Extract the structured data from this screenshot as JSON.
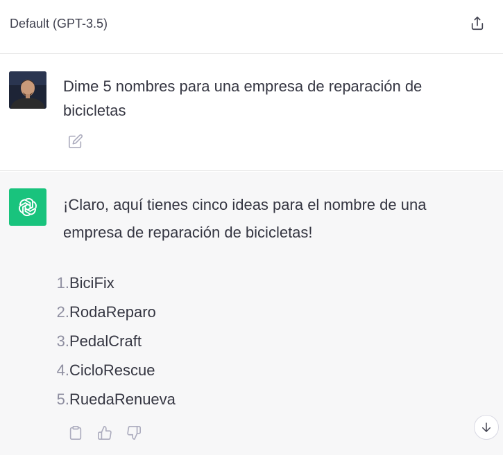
{
  "header": {
    "title": "Default (GPT-3.5)",
    "share_icon": "share-icon"
  },
  "user_message": {
    "text": "Dime 5 nombres para una empresa de reparación de bicicletas",
    "edit_icon": "edit-icon"
  },
  "assistant_message": {
    "intro": "¡Claro, aquí tienes cinco ideas para el nombre de una empresa de reparación de bicicletas!",
    "items": [
      {
        "number": "1.",
        "name": "BiciFix"
      },
      {
        "number": "2.",
        "name": "RodaReparo"
      },
      {
        "number": "3.",
        "name": "PedalCraft"
      },
      {
        "number": "4.",
        "name": "CicloRescue"
      },
      {
        "number": "5.",
        "name": "RuedaRenueva"
      }
    ],
    "action_icons": [
      "clipboard-icon",
      "thumbs-up-icon",
      "thumbs-down-icon"
    ]
  },
  "colors": {
    "bot_avatar_bg": "#19c37d",
    "assistant_bg": "#f7f7f8",
    "text": "#343541",
    "list_number": "#8e8ea0"
  }
}
